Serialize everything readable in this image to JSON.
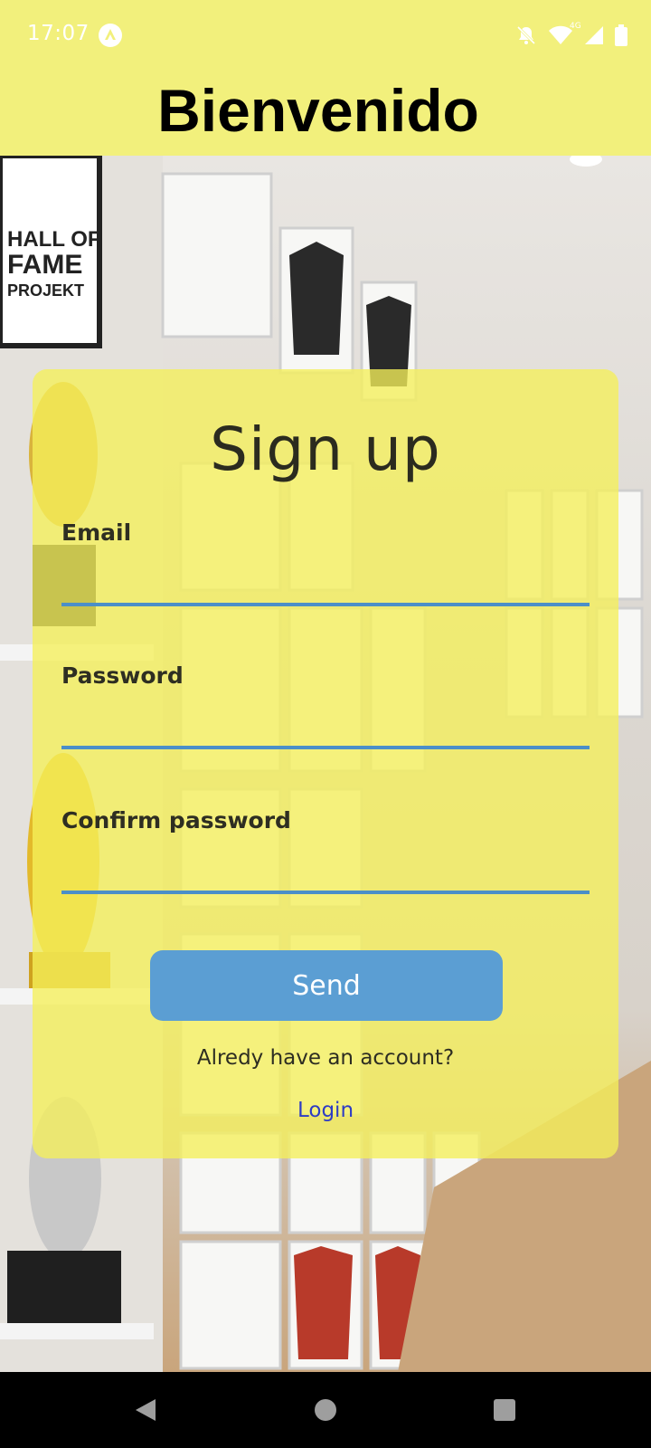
{
  "status_bar": {
    "time": "17:07",
    "network_label": "4G",
    "icons": [
      "app-notification-icon",
      "do-not-disturb-icon",
      "wifi-icon",
      "cell-signal-icon",
      "battery-icon"
    ]
  },
  "header": {
    "title": "Bienvenido",
    "background_color": "#f2f07c"
  },
  "form": {
    "title": "Sign up",
    "fields": [
      {
        "label": "Email",
        "value": ""
      },
      {
        "label": "Password",
        "value": ""
      },
      {
        "label": "Confirm password",
        "value": ""
      }
    ],
    "submit_label": "Send",
    "already_text": "Alredy have an account?",
    "login_link": "Login",
    "accent_color": "#5b9ed3",
    "link_color": "#2e3cc4"
  },
  "nav_bar": {
    "buttons": [
      "back-icon",
      "home-icon",
      "recents-icon"
    ]
  }
}
